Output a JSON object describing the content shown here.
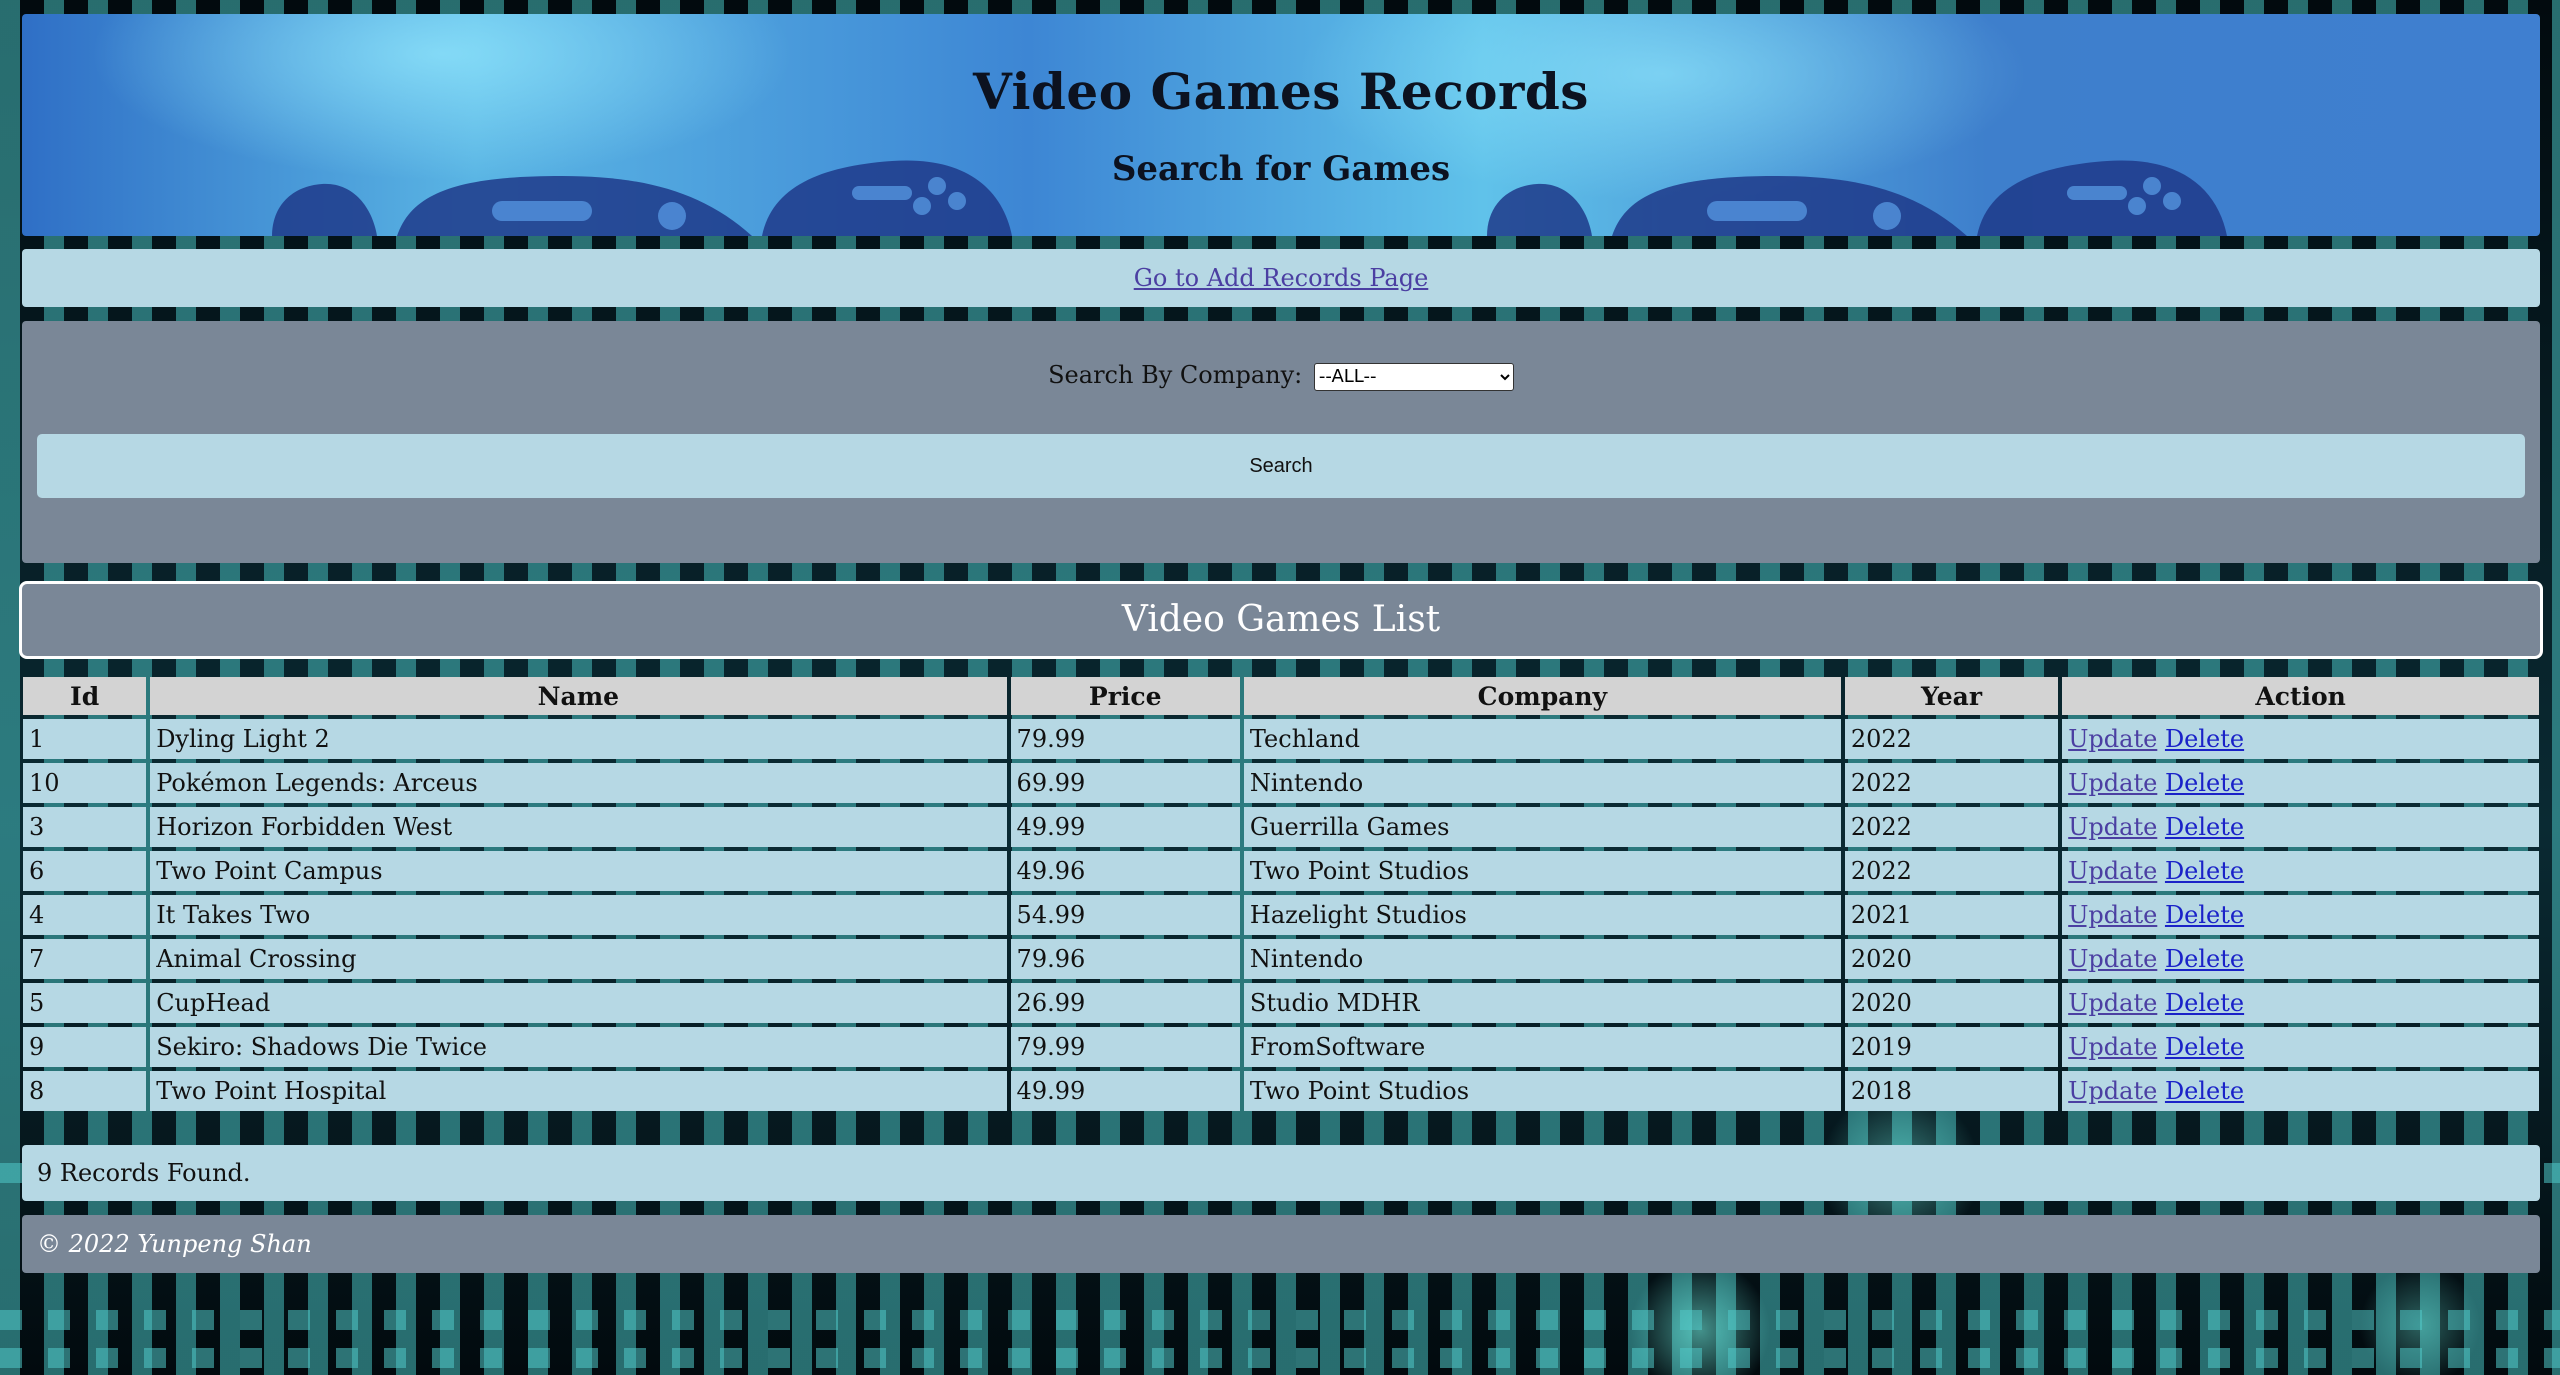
{
  "header": {
    "title": "Video Games Records",
    "subtitle": "Search for Games"
  },
  "nav": {
    "add_link": "Go to Add Records Page"
  },
  "search": {
    "label": "Search By Company:",
    "selected": "--ALL--",
    "button": "Search"
  },
  "list": {
    "title": "Video Games List",
    "columns": [
      "Id",
      "Name",
      "Price",
      "Company",
      "Year",
      "Action"
    ],
    "rows": [
      {
        "id": "1",
        "name": "Dyling Light 2",
        "price": "79.99",
        "company": "Techland",
        "year": "2022"
      },
      {
        "id": "10",
        "name": "Pokémon Legends: Arceus",
        "price": "69.99",
        "company": "Nintendo",
        "year": "2022"
      },
      {
        "id": "3",
        "name": "Horizon Forbidden West",
        "price": "49.99",
        "company": "Guerrilla Games",
        "year": "2022"
      },
      {
        "id": "6",
        "name": "Two Point Campus",
        "price": "49.96",
        "company": "Two Point Studios",
        "year": "2022"
      },
      {
        "id": "4",
        "name": "It Takes Two",
        "price": "54.99",
        "company": "Hazelight Studios",
        "year": "2021"
      },
      {
        "id": "7",
        "name": "Animal Crossing",
        "price": "79.96",
        "company": "Nintendo",
        "year": "2020"
      },
      {
        "id": "5",
        "name": "CupHead",
        "price": "26.99",
        "company": "Studio MDHR",
        "year": "2020"
      },
      {
        "id": "9",
        "name": "Sekiro: Shadows Die Twice",
        "price": "79.99",
        "company": "FromSoftware",
        "year": "2019"
      },
      {
        "id": "8",
        "name": "Two Point Hospital",
        "price": "49.99",
        "company": "Two Point Studios",
        "year": "2018"
      }
    ],
    "update_label": "Update",
    "delete_label": "Delete"
  },
  "status": {
    "count_text": "9 Records Found."
  },
  "footer": {
    "copyright": "© 2022 Yunpeng Shan"
  },
  "colors": {
    "panel_light": "#b6d8e4",
    "panel_dark": "#7a8797",
    "header_gray": "#d3d3d3",
    "link": "#4b3fa2"
  }
}
